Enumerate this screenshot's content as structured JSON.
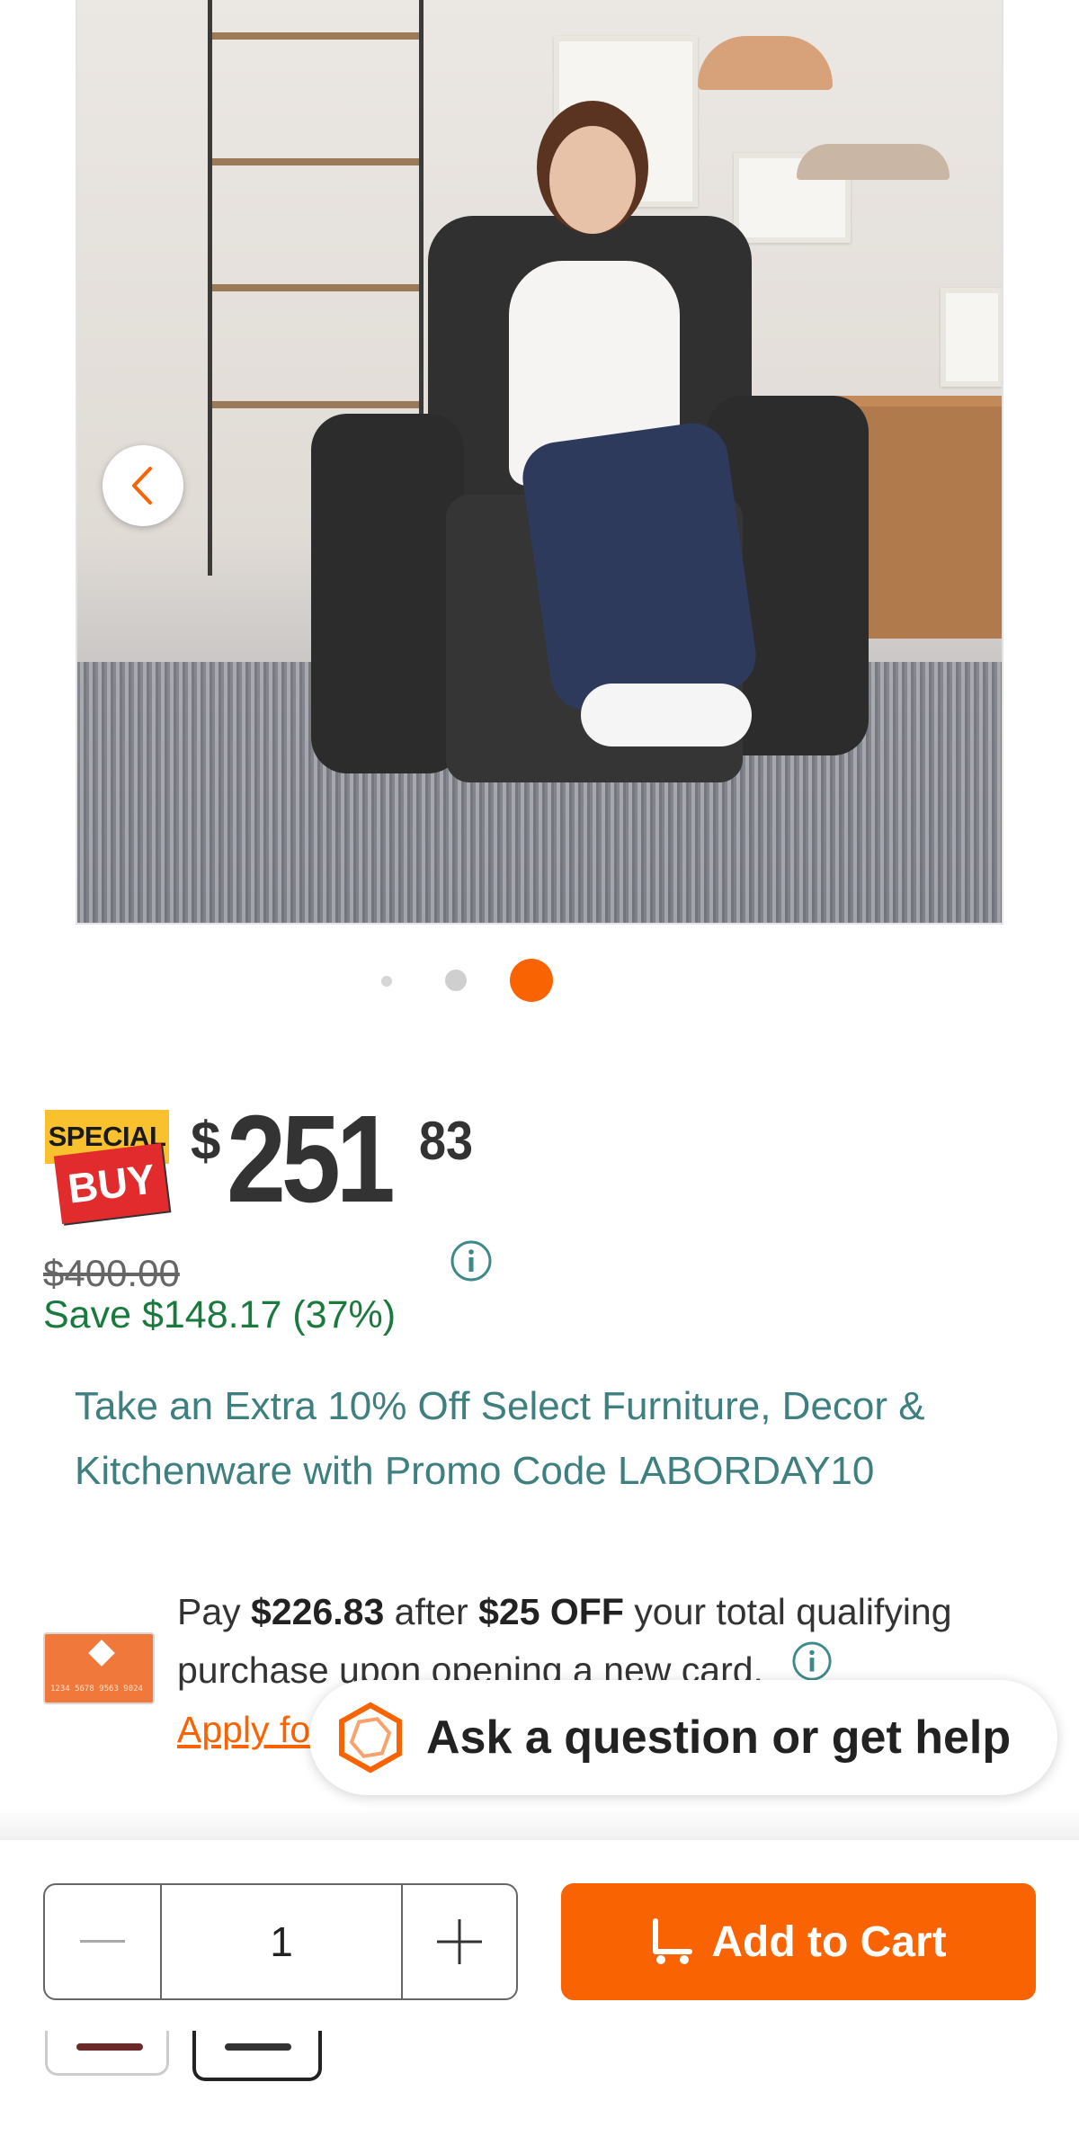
{
  "carousel": {
    "prev_icon": "chevron-left-icon",
    "total_dots": 3,
    "active_dot": 3,
    "active_color": "#f96302"
  },
  "badge": {
    "line1": "SPECIAL",
    "line2": "BUY"
  },
  "price": {
    "currency": "$",
    "dollars": "251",
    "cents": "83",
    "was": "$400.00",
    "savings": "Save $148.17 (37%)"
  },
  "promo": {
    "text": "Take an Extra 10% Off Select Furniture, Decor & Kitchenware with Promo Code LABORDAY10"
  },
  "credit_card": {
    "pay_prefix": "Pay ",
    "pay_amount": "$226.83",
    "pay_mid": " after ",
    "discount": "$25 OFF",
    "pay_suffix": " your total qualifying purchase upon opening a new card.",
    "apply_link": "Apply fo",
    "card_number": "1234 5678 9563 9024"
  },
  "help": {
    "label": "Ask a question or get help"
  },
  "cart": {
    "quantity": "1",
    "add_label": "Add to Cart"
  },
  "colors": {
    "brand_orange": "#f96302",
    "savings_green": "#1a7a3d",
    "promo_teal": "#3e7f7f"
  }
}
